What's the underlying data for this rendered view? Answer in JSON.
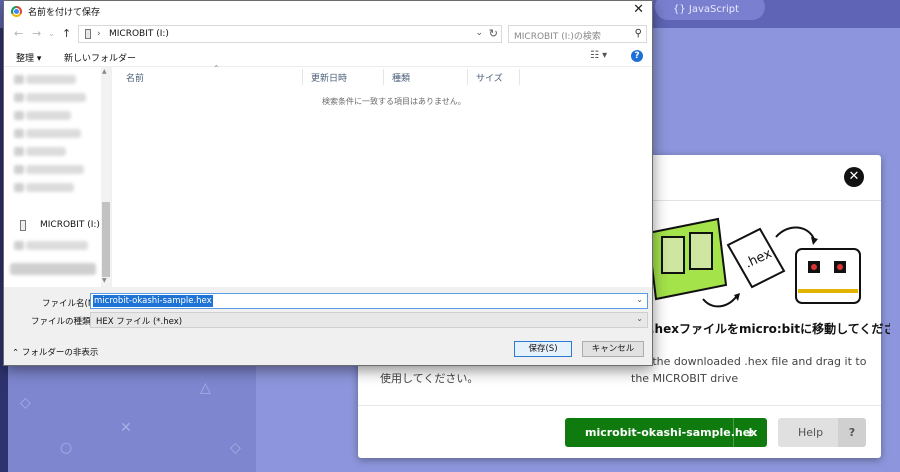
{
  "background": {
    "editor_tab": "{} JavaScript"
  },
  "modal": {
    "heading": ".hexファイルをmicro:bitに移動してくださ",
    "text_en": "ate the downloaded .hex file and drag it to the MICROBIT drive",
    "text_jp": "使用してください。",
    "download_label": "microbit-okashi-sample.hex",
    "help_label": "Help",
    "help_q": "?",
    "illustration_text": ".hex"
  },
  "dialog": {
    "title": "名前を付けて保存",
    "address": "MICROBIT (I:)",
    "search_placeholder": "MICROBIT (I:)の検索",
    "toolbar": {
      "organize": "整理 ▾",
      "new_folder": "新しいフォルダー"
    },
    "nav": {
      "microbit": "MICROBIT (I:)"
    },
    "columns": [
      "名前",
      "更新日時",
      "種類",
      "サイズ"
    ],
    "empty_message": "検索条件に一致する項目はありません。",
    "filename_label": "ファイル名(N):",
    "filename_value": "microbit-okashi-sample.hex",
    "filetype_label": "ファイルの種類(T):",
    "filetype_value": "HEX ファイル (*.hex)",
    "hide_folders": "フォルダーの非表示",
    "save_button": "保存(S)",
    "cancel_button": "キャンセル"
  },
  "colors": {
    "download_green": "#0f7b0f",
    "page_purple": "#8a93d8",
    "selection_blue": "#1e73d6"
  }
}
